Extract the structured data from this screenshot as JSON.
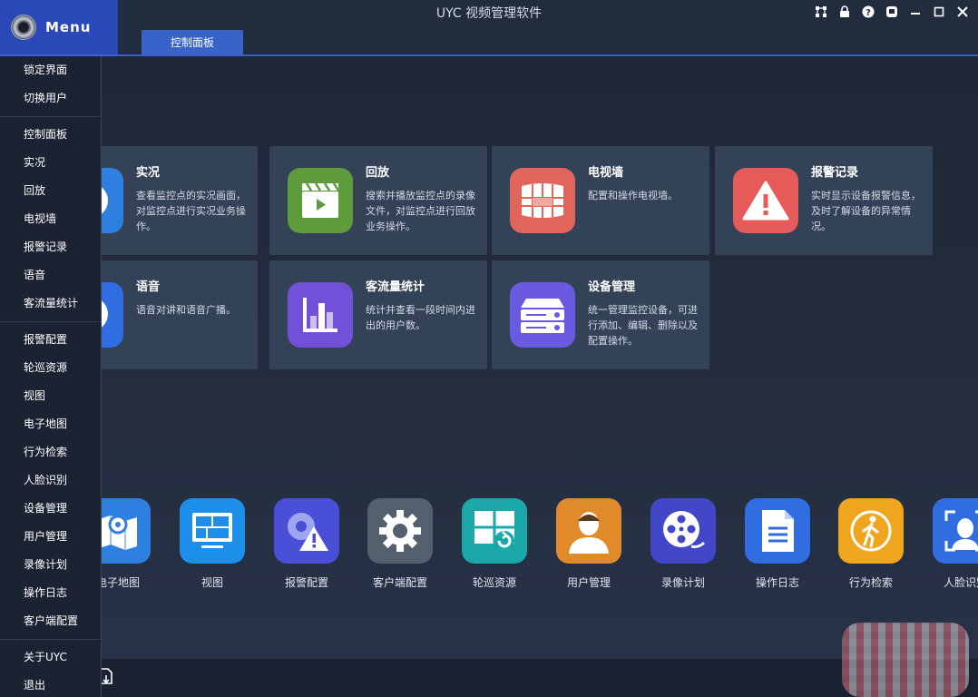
{
  "titlebar": {
    "menu_label": "Menu",
    "app_title": "UYC 视频管理软件",
    "active_tab": "控制面板"
  },
  "cards": [
    {
      "title": "实况",
      "desc": "查看监控点的实况画面，对监控点进行实况业务操作。",
      "color": "#2f7fe0",
      "icon": "live-view-icon"
    },
    {
      "title": "回放",
      "desc": "搜索并播放监控点的录像文件，对监控点进行回放业务操作。",
      "color": "#5e9b3a",
      "icon": "playback-clapper-icon"
    },
    {
      "title": "电视墙",
      "desc": "配置和操作电视墙。",
      "color": "#e0665c",
      "icon": "tv-wall-icon"
    },
    {
      "title": "报警记录",
      "desc": "实时显示设备报警信息，及时了解设备的异常情况。",
      "color": "#e65a5a",
      "icon": "alarm-warning-icon"
    },
    {
      "title": "语音",
      "desc": "语音对讲和语音广播。",
      "color": "#2f6de0",
      "icon": "microphone-icon"
    },
    {
      "title": "客流量统计",
      "desc": "统计并查看一段时间内进出的用户数。",
      "color": "#7250d8",
      "icon": "bar-chart-icon"
    },
    {
      "title": "设备管理",
      "desc": "统一管理监控设备，可进行添加、编辑、删除以及配置操作。",
      "color": "#6a5ae0",
      "icon": "device-server-icon"
    }
  ],
  "dock": [
    {
      "label": "电子地图",
      "color": "#2f7fe0",
      "icon": "map-icon"
    },
    {
      "label": "视图",
      "color": "#1e8fe8",
      "icon": "view-monitor-icon"
    },
    {
      "label": "报警配置",
      "color": "#4a4fd8",
      "icon": "alarm-config-icon"
    },
    {
      "label": "客户端配置",
      "color": "#55606e",
      "icon": "gear-icon"
    },
    {
      "label": "轮巡资源",
      "color": "#1aa8a8",
      "icon": "patrol-resource-icon"
    },
    {
      "label": "用户管理",
      "color": "#e08a2a",
      "icon": "user-icon"
    },
    {
      "label": "录像计划",
      "color": "#4147c8",
      "icon": "film-reel-icon"
    },
    {
      "label": "操作日志",
      "color": "#2f6de0",
      "icon": "document-log-icon"
    },
    {
      "label": "行为检索",
      "color": "#f0a51e",
      "icon": "walking-person-icon"
    },
    {
      "label": "人脸识别",
      "color": "#2f6de0",
      "icon": "face-recognition-icon"
    }
  ],
  "menu": {
    "groups": [
      [
        "锁定界面",
        "切换用户"
      ],
      [
        "控制面板",
        "实况",
        "回放",
        "电视墙",
        "报警记录",
        "语音",
        "客流量统计"
      ],
      [
        "报警配置",
        "轮巡资源",
        "视图",
        "电子地图",
        "行为检索",
        "人脸识别",
        "设备管理",
        "用户管理",
        "录像计划",
        "操作日志",
        "客户端配置"
      ],
      [
        "关于UYC",
        "退出"
      ]
    ]
  }
}
